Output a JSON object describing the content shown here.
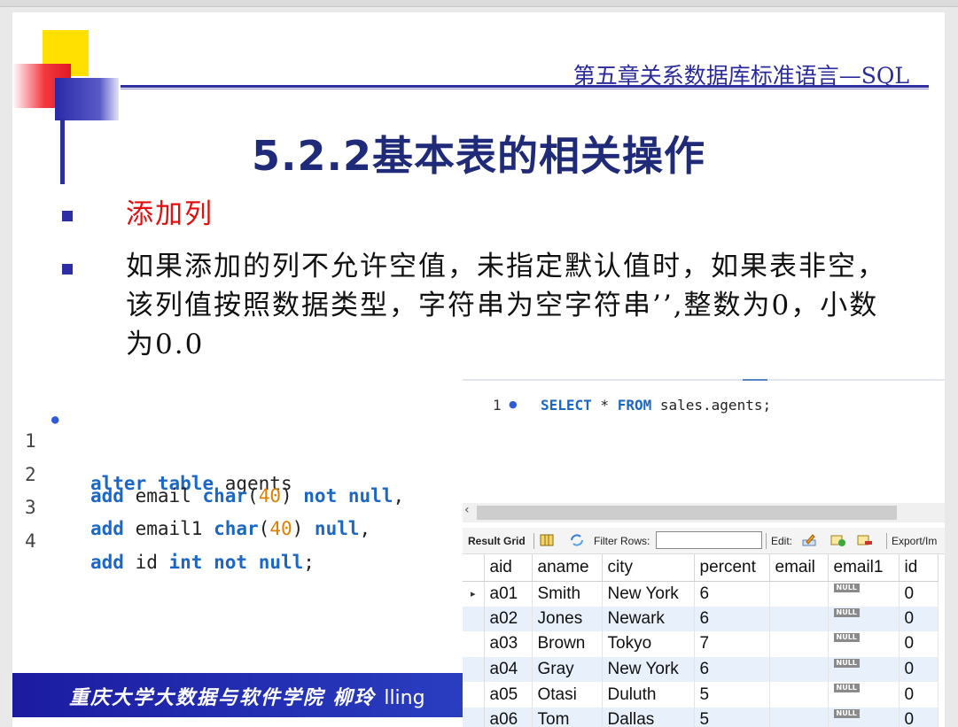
{
  "chapter_title": "第五章关系数据库标准语言—SQL",
  "slide_title": "5.2.2基本表的相关操作",
  "bullets": [
    "添加列",
    "如果添加的列不允许空值，未指定默认值时，如果表非空，该列值按照数据类型，字符串为空字符串’’,整数为0，小数为0.0"
  ],
  "code": {
    "lines": [
      {
        "n": "1",
        "marked": true
      },
      {
        "n": "2",
        "marked": false
      },
      {
        "n": "3",
        "marked": false
      },
      {
        "n": "4",
        "marked": false
      }
    ],
    "tokens": {
      "alter": "alter",
      "table": "table",
      "agents": " agents",
      "add": "add",
      "email": " email ",
      "char": "char",
      "lp": "(",
      "forty": "40",
      "rp": ") ",
      "not": "not",
      "null": "null",
      "comma": ",",
      "email1": " email1 ",
      "id": " id ",
      "int": "int",
      "semi": ";"
    }
  },
  "query": {
    "line_no": "1",
    "select": "SELECT",
    "star": " * ",
    "from": "FROM",
    "target": " sales.agents;"
  },
  "toolbar": {
    "result_grid": "Result Grid",
    "filter_rows": "Filter Rows:",
    "edit": "Edit:",
    "export": "Export/Im"
  },
  "grid": {
    "columns": [
      "aid",
      "aname",
      "city",
      "percent",
      "email",
      "email1",
      "id"
    ],
    "null_badge": "NULL",
    "rows": [
      {
        "aid": "a01",
        "aname": "Smith",
        "city": "New York",
        "percent": "6",
        "id": "0"
      },
      {
        "aid": "a02",
        "aname": "Jones",
        "city": "Newark",
        "percent": "6",
        "id": "0"
      },
      {
        "aid": "a03",
        "aname": "Brown",
        "city": "Tokyo",
        "percent": "7",
        "id": "0"
      },
      {
        "aid": "a04",
        "aname": "Gray",
        "city": "New York",
        "percent": "6",
        "id": "0"
      },
      {
        "aid": "a05",
        "aname": "Otasi",
        "city": "Duluth",
        "percent": "5",
        "id": "0"
      },
      {
        "aid": "a06",
        "aname": "Tom",
        "city": "Dallas",
        "percent": "5",
        "id": "0"
      }
    ]
  },
  "footer": {
    "text": "重庆大学大数据与软件学院 柳玲 ",
    "tail": "lling"
  }
}
